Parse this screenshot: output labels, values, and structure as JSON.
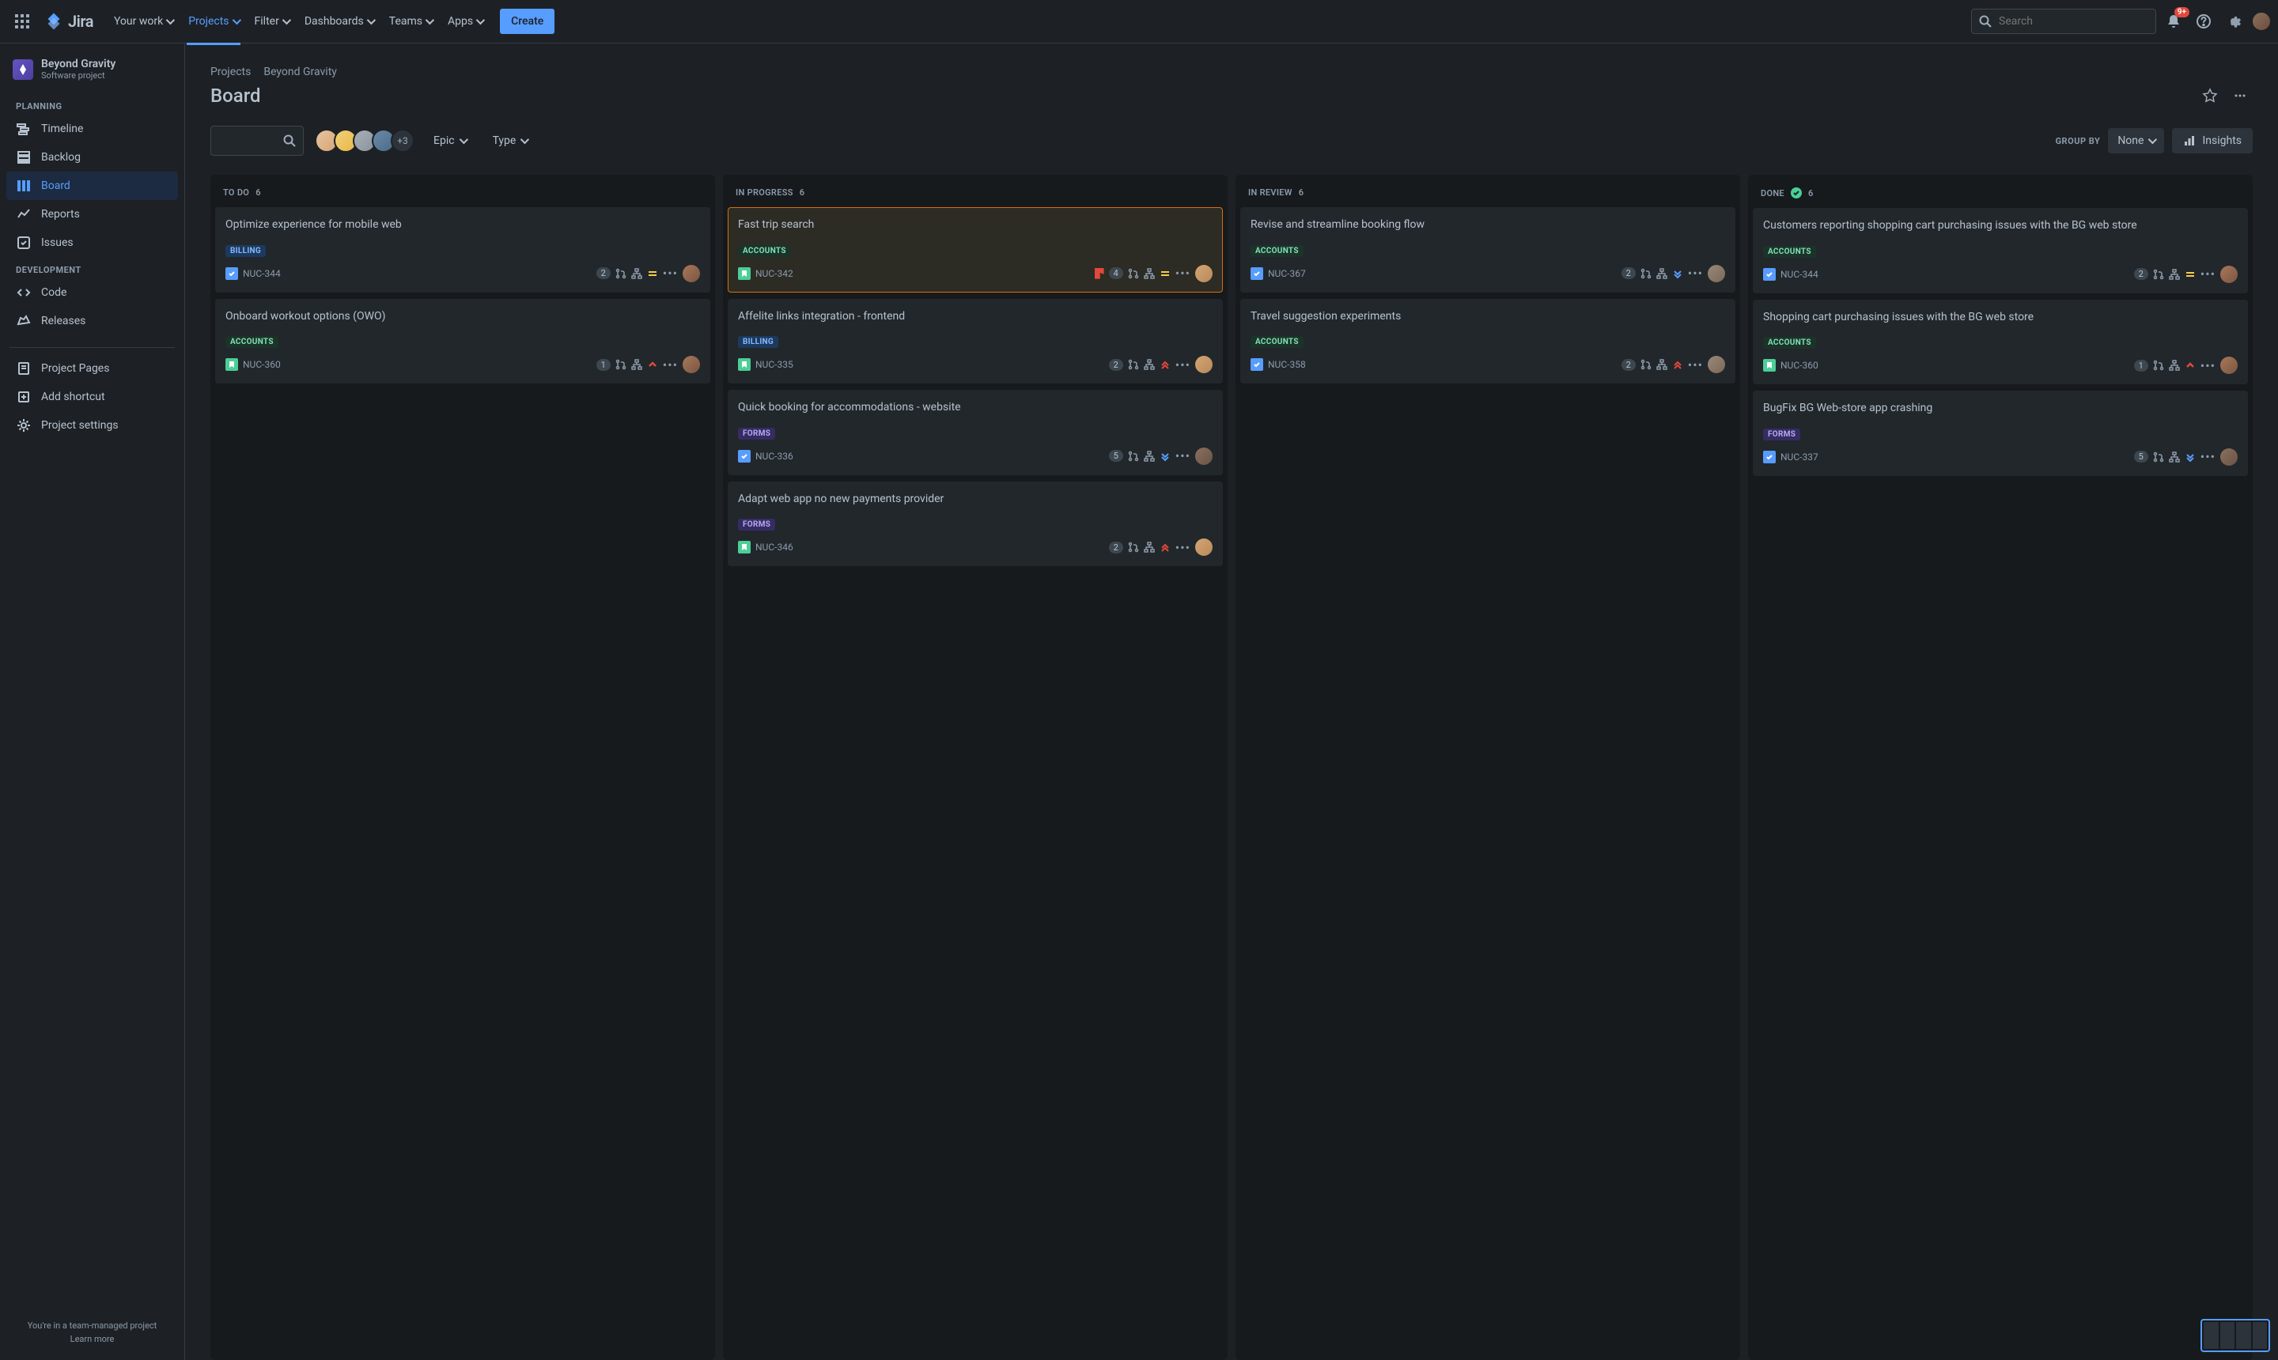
{
  "topbar": {
    "nav": [
      "Your work",
      "Projects",
      "Filter",
      "Dashboards",
      "Teams",
      "Apps"
    ],
    "create": "Create",
    "search_placeholder": "Search",
    "notif_badge": "9+"
  },
  "sidebar": {
    "project_name": "Beyond Gravity",
    "project_sub": "Software project",
    "sections": {
      "planning": {
        "label": "PLANNING",
        "items": [
          "Timeline",
          "Backlog",
          "Board",
          "Reports",
          "Issues"
        ]
      },
      "development": {
        "label": "DEVELOPMENT",
        "items": [
          "Code",
          "Releases"
        ]
      },
      "project": {
        "items": [
          "Project Pages",
          "Add shortcut",
          "Project settings"
        ]
      }
    },
    "footer": "You're in a team-managed project",
    "learn": "Learn more"
  },
  "breadcrumb": [
    "Projects",
    "Beyond Gravity"
  ],
  "board_title": "Board",
  "filters": {
    "more_avatars": "+3",
    "epic": "Epic",
    "type": "Type",
    "group_by": "GROUP BY",
    "none": "None",
    "insights": "Insights"
  },
  "columns": [
    {
      "name": "TO DO",
      "count": "6"
    },
    {
      "name": "IN PROGRESS",
      "count": "6"
    },
    {
      "name": "IN REVIEW",
      "count": "6"
    },
    {
      "name": "DONE",
      "count": "6",
      "done": true
    }
  ],
  "cards": {
    "todo": [
      {
        "title": "Optimize experience for mobile web",
        "tag": "BILLING",
        "tagcls": "billing",
        "type": "task",
        "key": "NUC-344",
        "pill": "2",
        "prio": "medium",
        "av": "cav1"
      },
      {
        "title": "Onboard workout options (OWO)",
        "tag": "ACCOUNTS",
        "tagcls": "accounts",
        "type": "story",
        "key": "NUC-360",
        "pill": "1",
        "prio": "high",
        "av": "cav1"
      }
    ],
    "progress": [
      {
        "title": "Fast trip search",
        "tag": "ACCOUNTS",
        "tagcls": "accounts",
        "type": "story",
        "key": "NUC-342",
        "pill": "4",
        "flag": true,
        "prio": "medium",
        "av": "cav2",
        "hl": true
      },
      {
        "title": "Affelite links integration - frontend",
        "tag": "BILLING",
        "tagcls": "billing",
        "type": "story",
        "key": "NUC-335",
        "pill": "2",
        "prio": "highest",
        "av": "cav2"
      },
      {
        "title": "Quick booking for accommodations - website",
        "tag": "FORMS",
        "tagcls": "forms",
        "type": "task",
        "key": "NUC-336",
        "pill": "5",
        "prio": "low",
        "av": "cav3"
      },
      {
        "title": "Adapt web app no new payments provider",
        "tag": "FORMS",
        "tagcls": "forms",
        "type": "story",
        "key": "NUC-346",
        "pill": "2",
        "prio": "highest",
        "av": "cav2"
      }
    ],
    "review": [
      {
        "title": "Revise and streamline booking flow",
        "tag": "ACCOUNTS",
        "tagcls": "accounts",
        "type": "task",
        "key": "NUC-367",
        "pill": "2",
        "prio": "low",
        "av": "cav4"
      },
      {
        "title": "Travel suggestion experiments",
        "tag": "ACCOUNTS",
        "tagcls": "accounts",
        "type": "task",
        "key": "NUC-358",
        "pill": "2",
        "prio": "highest",
        "av": "cav4"
      }
    ],
    "done": [
      {
        "title": "Customers reporting shopping cart purchasing issues with the BG web store",
        "tag": "ACCOUNTS",
        "tagcls": "accounts",
        "type": "task",
        "key": "NUC-344",
        "pill": "2",
        "prio": "medium",
        "av": "cav1"
      },
      {
        "title": "Shopping cart purchasing issues with the BG web store",
        "tag": "ACCOUNTS",
        "tagcls": "accounts",
        "type": "story",
        "key": "NUC-360",
        "pill": "1",
        "prio": "high",
        "av": "cav1"
      },
      {
        "title": "BugFix BG Web-store app crashing",
        "tag": "FORMS",
        "tagcls": "forms",
        "type": "task",
        "key": "NUC-337",
        "pill": "5",
        "prio": "low",
        "av": "cav3"
      }
    ]
  }
}
